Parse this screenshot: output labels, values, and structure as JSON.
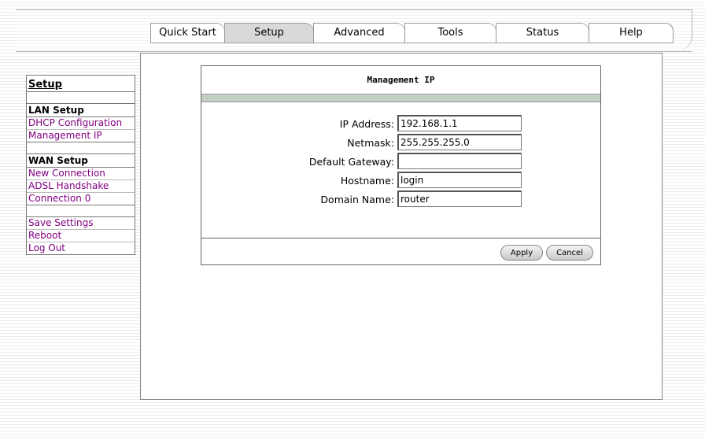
{
  "nav": {
    "tabs": [
      {
        "label": "Quick Start"
      },
      {
        "label": "Setup"
      },
      {
        "label": "Advanced"
      },
      {
        "label": "Tools"
      },
      {
        "label": "Status"
      },
      {
        "label": "Help"
      }
    ],
    "active_tab": "Setup"
  },
  "sidebar": {
    "title": "Setup",
    "lan": {
      "heading": "LAN Setup",
      "links": [
        "DHCP Configuration",
        "Management IP"
      ]
    },
    "wan": {
      "heading": "WAN Setup",
      "links": [
        "New Connection",
        "ADSL Handshake",
        "Connection 0"
      ]
    },
    "actions": [
      "Save Settings",
      "Reboot",
      "Log Out"
    ]
  },
  "panel": {
    "title": "Management IP",
    "fields": [
      {
        "label": "IP Address:",
        "value": "192.168.1.1"
      },
      {
        "label": "Netmask:",
        "value": "255.255.255.0"
      },
      {
        "label": "Default Gateway:",
        "value": ""
      },
      {
        "label": "Hostname:",
        "value": "login"
      },
      {
        "label": "Domain Name:",
        "value": "router"
      }
    ],
    "apply_label": "Apply",
    "cancel_label": "Cancel"
  },
  "colors": {
    "link": "#800080",
    "title_bar": "#c3cfc3",
    "active_tab": "#d9d9d9"
  }
}
